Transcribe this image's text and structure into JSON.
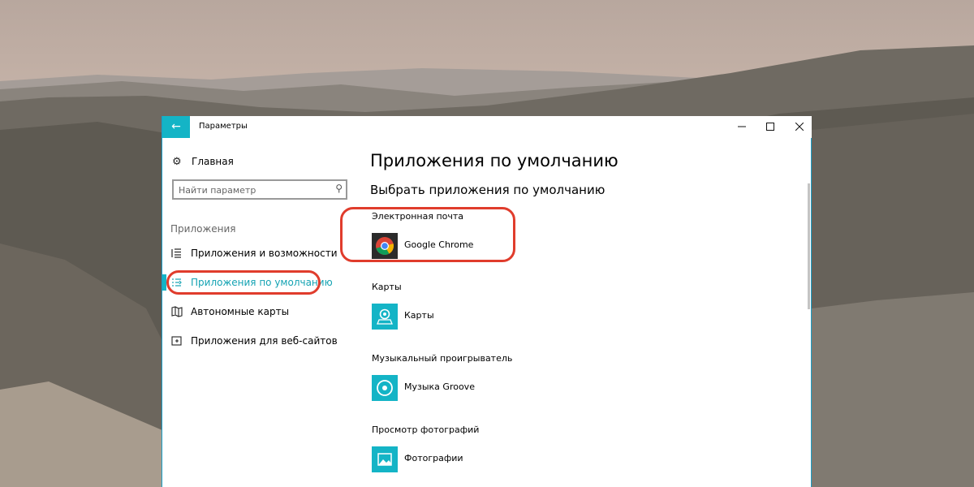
{
  "window": {
    "title": "Параметры",
    "accent": "#14b4c6",
    "highlight": "#e03c2c"
  },
  "titlebar": {
    "back_icon": "arrow-left-icon",
    "minimize_icon": "minimize-icon",
    "maximize_icon": "maximize-icon",
    "close_icon": "close-icon"
  },
  "sidebar": {
    "home": {
      "label": "Главная",
      "icon": "gear-icon"
    },
    "search": {
      "placeholder": "Найти параметр",
      "icon": "search-icon"
    },
    "section": "Приложения",
    "items": [
      {
        "label": "Приложения и возможности",
        "icon": "list-icon",
        "active": false
      },
      {
        "label": "Приложения по умолчанию",
        "icon": "default-apps-icon",
        "active": true
      },
      {
        "label": "Автономные карты",
        "icon": "map-icon",
        "active": false
      },
      {
        "label": "Приложения для веб-сайтов",
        "icon": "external-link-icon",
        "active": false
      }
    ]
  },
  "main": {
    "title": "Приложения по умолчанию",
    "subtitle": "Выбрать приложения по умолчанию",
    "defaults": [
      {
        "category": "Электронная почта",
        "app": "Google Chrome",
        "icon": "chrome-icon"
      },
      {
        "category": "Карты",
        "app": "Карты",
        "icon": "maps-app-icon"
      },
      {
        "category": "Музыкальный проигрыватель",
        "app": "Музыка Groove",
        "icon": "groove-music-icon"
      },
      {
        "category": "Просмотр фотографий",
        "app": "Фотографии",
        "icon": "photos-app-icon"
      }
    ]
  }
}
